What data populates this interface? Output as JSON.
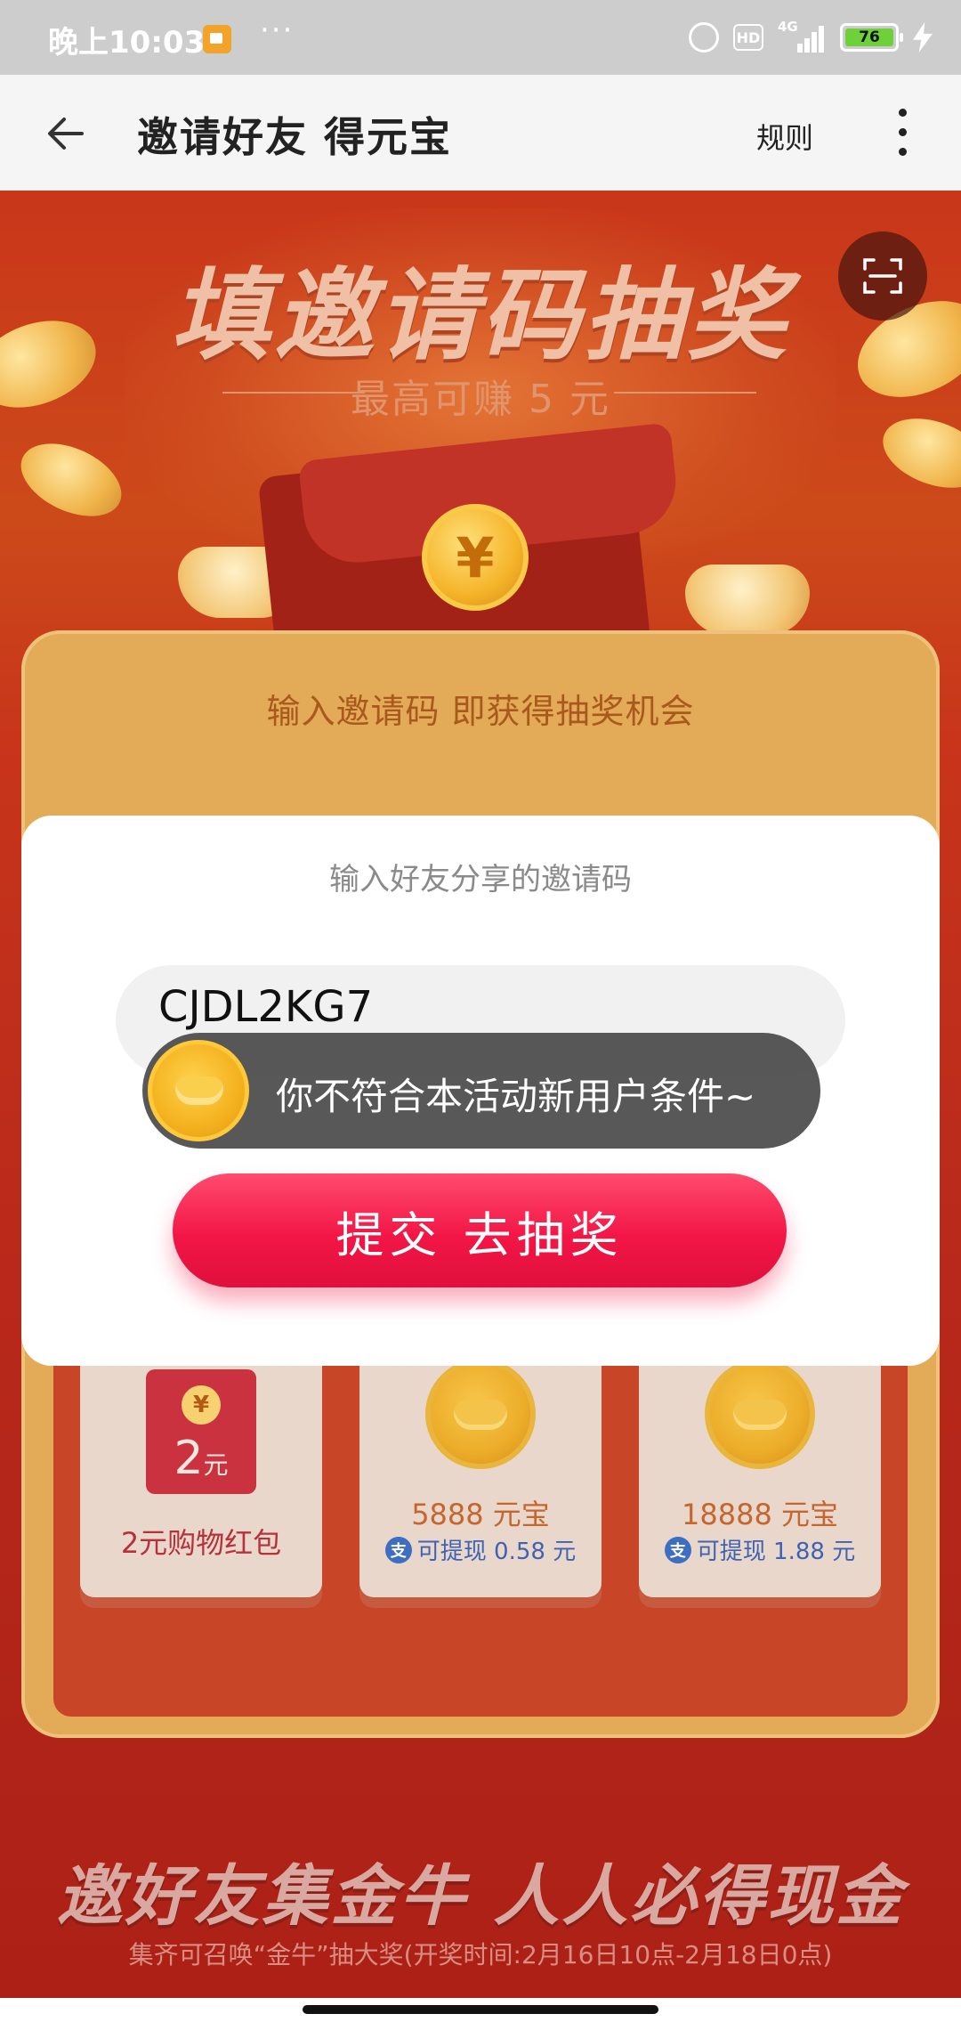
{
  "status_bar": {
    "time": "晚上10:03",
    "dots": "···",
    "network": "4G",
    "hd": "HD",
    "battery": "76"
  },
  "nav": {
    "title": "邀请好友 得元宝",
    "rules": "规则"
  },
  "banner": {
    "title": "填邀请码抽奖",
    "subtitle": "最高可赚 5 元",
    "coin_symbol": "¥"
  },
  "card": {
    "heading": "输入邀请码 即获得抽奖机会"
  },
  "modal": {
    "title": "输入好友分享的邀请码",
    "code_value": "CJDL2KG7",
    "submit_label": "提交 去抽奖"
  },
  "toast": {
    "message": "你不符合本活动新用户条件~"
  },
  "prizes": [
    {
      "redpack_symbol": "¥",
      "amount": "2",
      "unit": "元",
      "label": "2元购物红包"
    },
    {
      "amount": "5888 元宝",
      "cash": "可提现 0.58 元"
    },
    {
      "amount": "18888 元宝",
      "cash": "可提现 1.88 元"
    }
  ],
  "alipay_glyph": "支",
  "footer": {
    "slogan": "邀好友集金牛 人人必得现金",
    "note": "集齐可召唤“金牛”抽大奖(开奖时间:2月16日10点-2月18日0点)"
  },
  "colors": {
    "accent": "#f21646",
    "banner_red": "#c9361a",
    "gold": "#e3ab57"
  }
}
